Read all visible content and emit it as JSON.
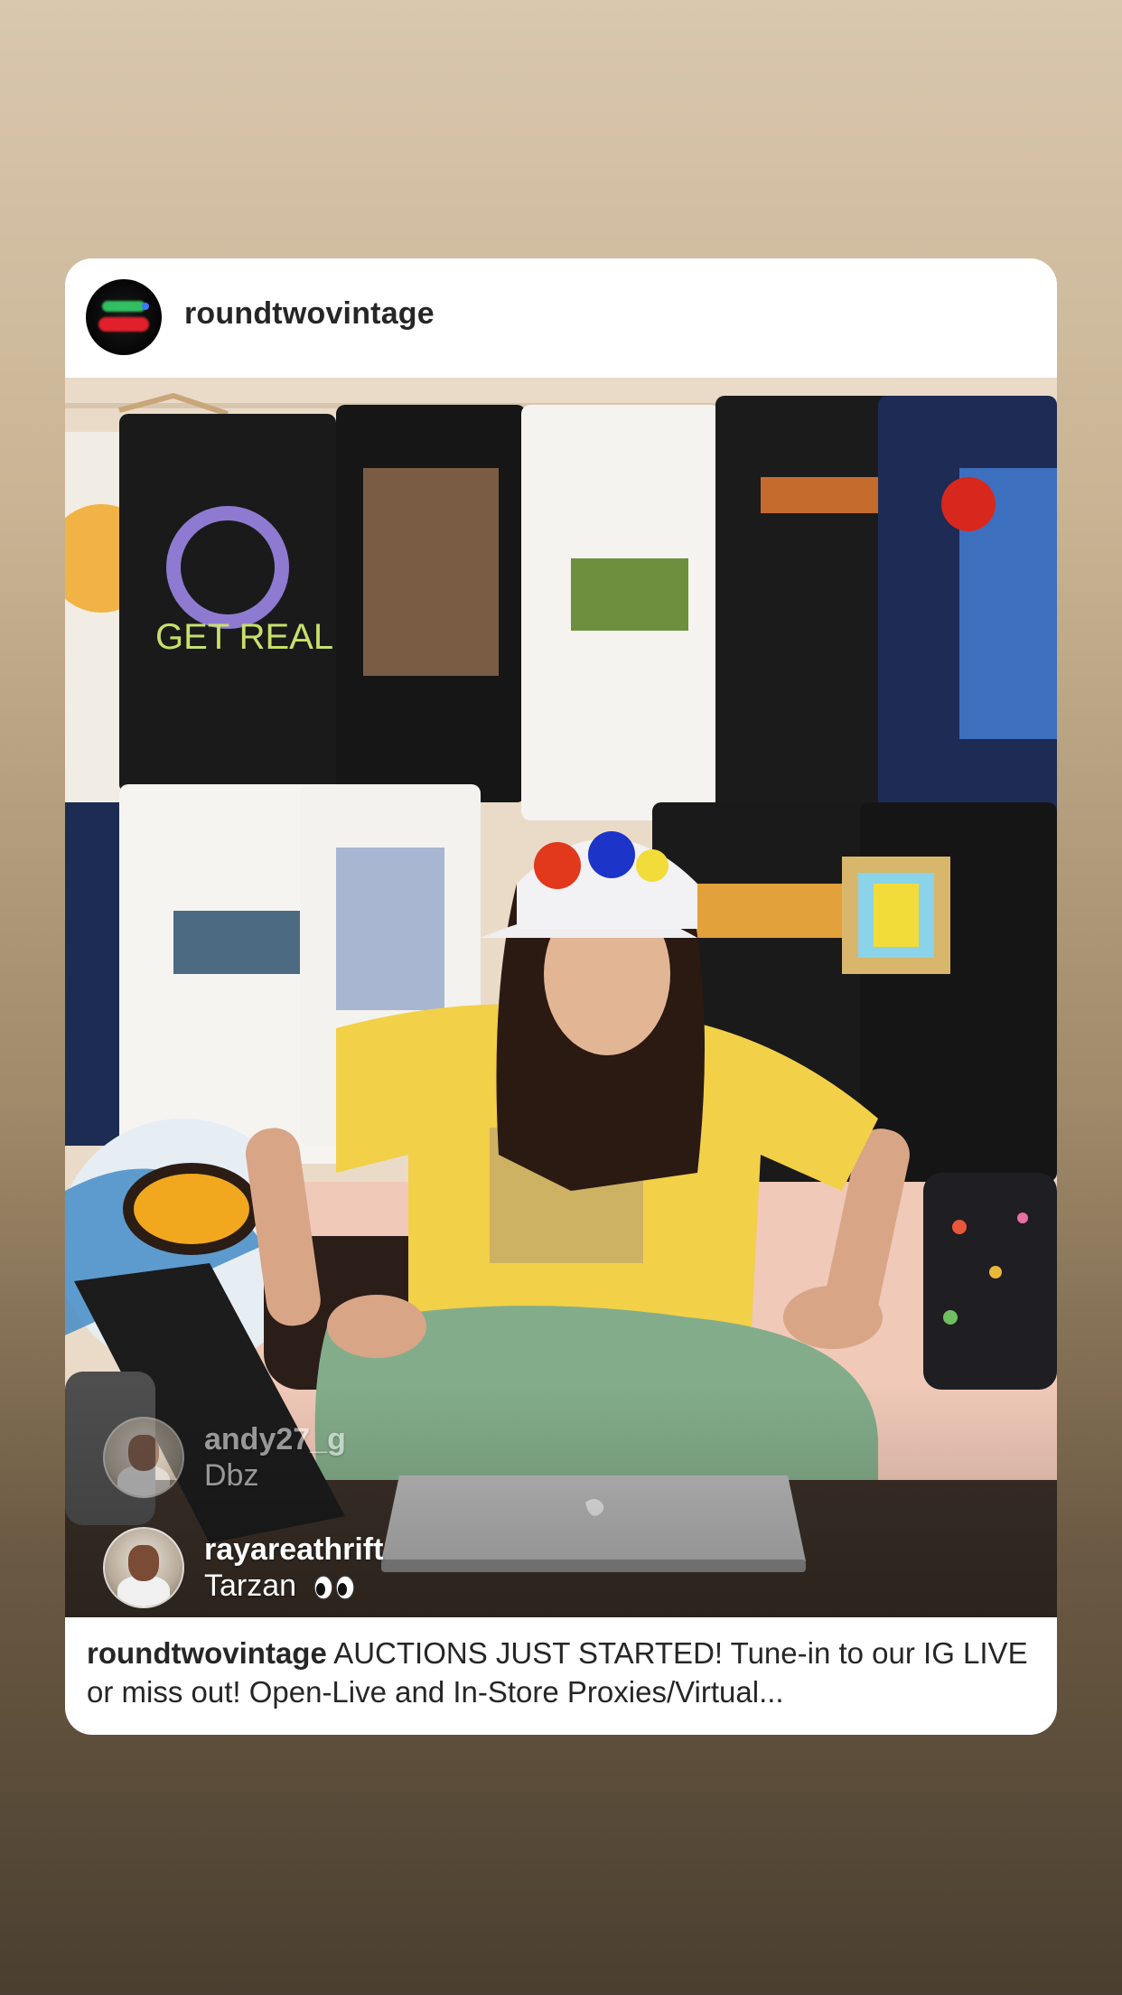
{
  "post": {
    "username": "roundtwovintage"
  },
  "live_comments": [
    {
      "user": "andy27_g",
      "message": "Dbz"
    },
    {
      "user": "rayareathrift",
      "message": "Tarzan"
    }
  ],
  "caption": {
    "username": "roundtwovintage",
    "text": "AUCTIONS JUST STARTED! Tune-in to our IG LIVE or miss out! Open-Live and In-Store Proxies/Virtual..."
  },
  "icons": {
    "post_avatar": "profile-avatar-icon",
    "eyes": "eyes-emoji-icon"
  }
}
